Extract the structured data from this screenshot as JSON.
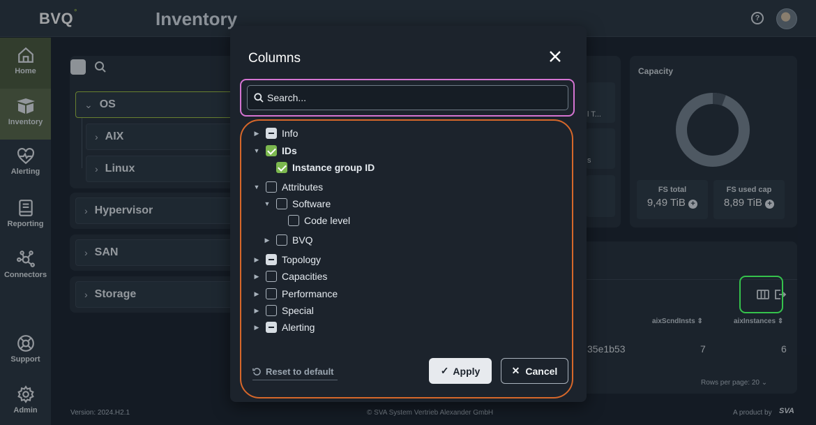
{
  "app": {
    "logo": "BVQ",
    "logo_mark": "°",
    "page_title": "Inventory"
  },
  "header": {
    "help_icon": "question-circle-icon",
    "avatar_icon": "user-avatar"
  },
  "sidebar": {
    "items": [
      {
        "label": "Home",
        "icon": "home-icon"
      },
      {
        "label": "Inventory",
        "icon": "box-icon"
      },
      {
        "label": "Alerting",
        "icon": "heart-pulse-icon"
      },
      {
        "label": "Reporting",
        "icon": "book-icon"
      },
      {
        "label": "Connectors",
        "icon": "network-icon"
      },
      {
        "label": "Support",
        "icon": "lifebuoy-icon"
      },
      {
        "label": "Admin",
        "icon": "gear-icon"
      }
    ]
  },
  "tree": {
    "items": [
      {
        "label": "OS"
      },
      {
        "label": "AIX"
      },
      {
        "label": "Linux"
      },
      {
        "label": "Hypervisor"
      },
      {
        "label": "SAN"
      },
      {
        "label": "Storage"
      }
    ]
  },
  "bg_cards": {
    "truncated_1": "l T...",
    "truncated_2": "s",
    "capacity_title": "Capacity",
    "fs_total_label": "FS total",
    "fs_total_value": "9,49 TiB",
    "fs_used_label": "FS used cap",
    "fs_used_value": "8,89 TiB"
  },
  "table": {
    "columns": [
      "aixScndInsts",
      "aixInstances"
    ],
    "row": {
      "id": "35e1b53",
      "aixScndInsts": "7",
      "aixInstances": "6"
    },
    "rows_per_page_label": "Rows per page:",
    "rows_per_page_value": "20"
  },
  "footer": {
    "version": "Version: 2024.H2.1",
    "copyright": "© SVA System Vertrieb Alexander GmbH",
    "product_by": "A product by",
    "brand": "SVA"
  },
  "modal": {
    "title": "Columns",
    "search_placeholder": "Search...",
    "items": [
      {
        "label": "Info",
        "state": "partial",
        "expand": "collapsed"
      },
      {
        "label": "IDs",
        "state": "checked",
        "expand": "expanded"
      },
      {
        "label": "Instance group ID",
        "state": "checked",
        "expand": "none"
      },
      {
        "label": "Attributes",
        "state": "unchecked",
        "expand": "expanded"
      },
      {
        "label": "Software",
        "state": "unchecked",
        "expand": "expanded"
      },
      {
        "label": "Code level",
        "state": "unchecked",
        "expand": "none"
      },
      {
        "label": "BVQ",
        "state": "unchecked",
        "expand": "collapsed"
      },
      {
        "label": "Topology",
        "state": "partial",
        "expand": "collapsed"
      },
      {
        "label": "Capacities",
        "state": "unchecked",
        "expand": "collapsed"
      },
      {
        "label": "Performance",
        "state": "unchecked",
        "expand": "collapsed"
      },
      {
        "label": "Special",
        "state": "unchecked",
        "expand": "collapsed"
      },
      {
        "label": "Alerting",
        "state": "partial",
        "expand": "collapsed"
      }
    ],
    "reset_label": "Reset to default",
    "apply_label": "Apply",
    "cancel_label": "Cancel"
  },
  "colors": {
    "accent_green": "#7cb84f",
    "highlight_pink": "#d574d2",
    "highlight_orange": "#d6672a",
    "highlight_green": "#35c24c"
  }
}
